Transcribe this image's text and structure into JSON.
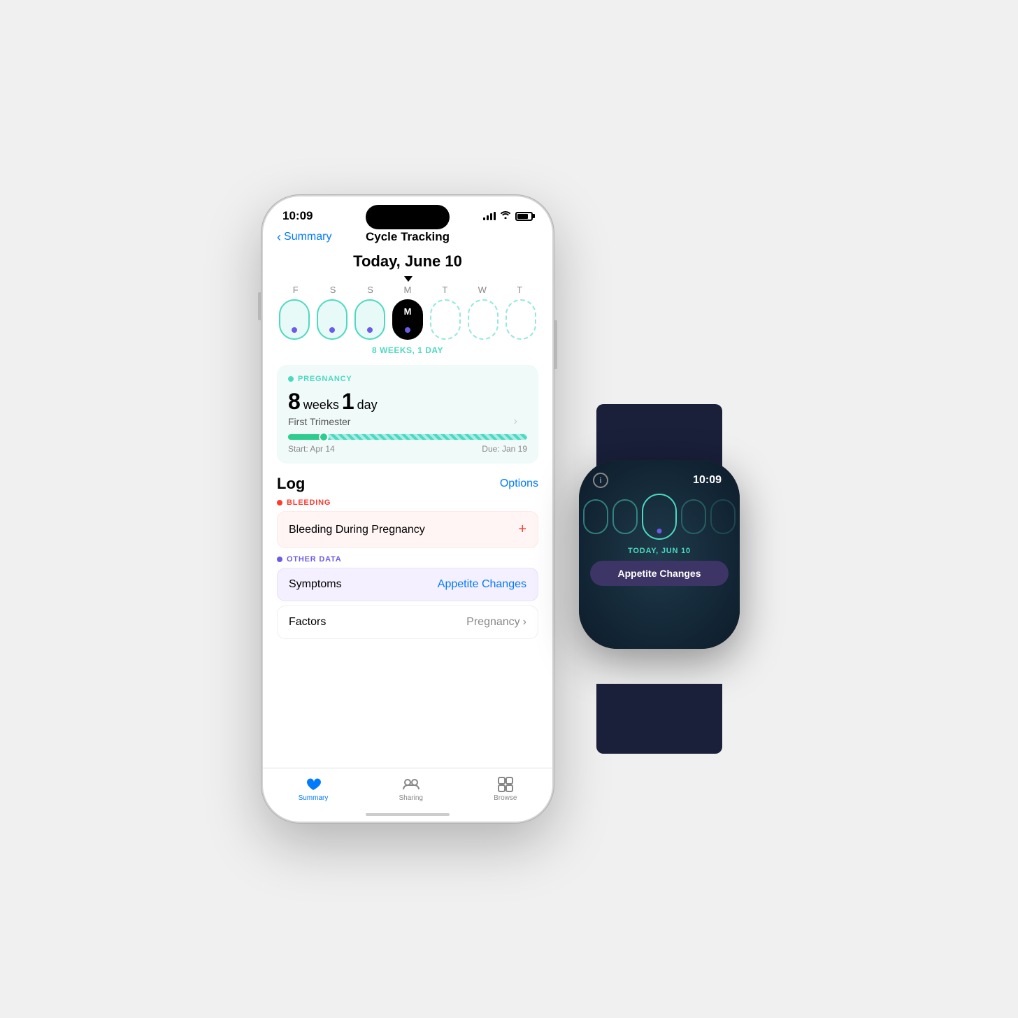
{
  "scene": {
    "background_color": "#efefef"
  },
  "iphone": {
    "status_bar": {
      "time": "10:09",
      "signal": "●●●●",
      "wifi": "wifi",
      "battery": "battery"
    },
    "nav": {
      "back_label": "Summary",
      "title": "Cycle Tracking"
    },
    "date_header": "Today, June 10",
    "calendar": {
      "day_labels": [
        "F",
        "S",
        "S",
        "M",
        "T",
        "W",
        "T"
      ],
      "current_day": "M",
      "weeks_label": "8 WEEKS, 1 DAY"
    },
    "pregnancy": {
      "section_label": "PREGNANCY",
      "weeks_num": "8",
      "weeks_unit": "weeks",
      "day_num": "1",
      "day_unit": "day",
      "trimester": "First Trimester",
      "start_label": "Start: Apr 14",
      "due_label": "Due: Jan 19"
    },
    "log": {
      "title": "Log",
      "options_label": "Options",
      "bleeding_label": "BLEEDING",
      "bleeding_item": "Bleeding During Pregnancy",
      "other_data_label": "OTHER DATA",
      "symptoms_label": "Symptoms",
      "symptoms_value": "Appetite Changes",
      "factors_label": "Factors",
      "factors_value": "Pregnancy"
    },
    "tab_bar": {
      "summary_label": "Summary",
      "sharing_label": "Sharing",
      "browse_label": "Browse"
    }
  },
  "watch": {
    "time": "10:09",
    "date_label": "TODAY, JUN 10",
    "action_label": "Appetite Changes",
    "info_icon": "i"
  }
}
